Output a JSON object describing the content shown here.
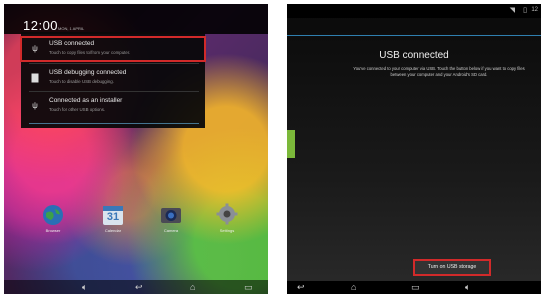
{
  "left": {
    "clock": "12:00",
    "date": "MON, 1 APRIL",
    "notifications": [
      {
        "title": "USB connected",
        "subtitle": "Touch to copy files to/from your computer.",
        "icon": "usb-icon"
      },
      {
        "title": "USB debugging connected",
        "subtitle": "Touch to disable USB debugging.",
        "icon": "debug-icon"
      },
      {
        "title": "Connected as an installer",
        "subtitle": "Touch for other USB options.",
        "icon": "usb-icon"
      }
    ],
    "apps": [
      {
        "label": "Browser",
        "icon": "globe-icon"
      },
      {
        "label": "Calendar",
        "icon": "calendar-icon"
      },
      {
        "label": "Camera",
        "icon": "camera-icon"
      },
      {
        "label": "Settings",
        "icon": "gear-icon"
      }
    ],
    "calendar_day": "31",
    "nav": [
      "volume-icon",
      "back-icon",
      "home-icon",
      "recents-icon"
    ],
    "accent": "#d12a2a"
  },
  "right": {
    "status_time": "12",
    "title": "USB connected",
    "description": "You've connected to your computer via USB. Touch the button below if you want to copy files between your computer and your Android's SD card.",
    "button_label": "Turn on USB storage",
    "nav": [
      "back-icon",
      "home-icon",
      "recents-icon",
      "volume-icon"
    ],
    "accent_line": "#2f7fb0"
  }
}
